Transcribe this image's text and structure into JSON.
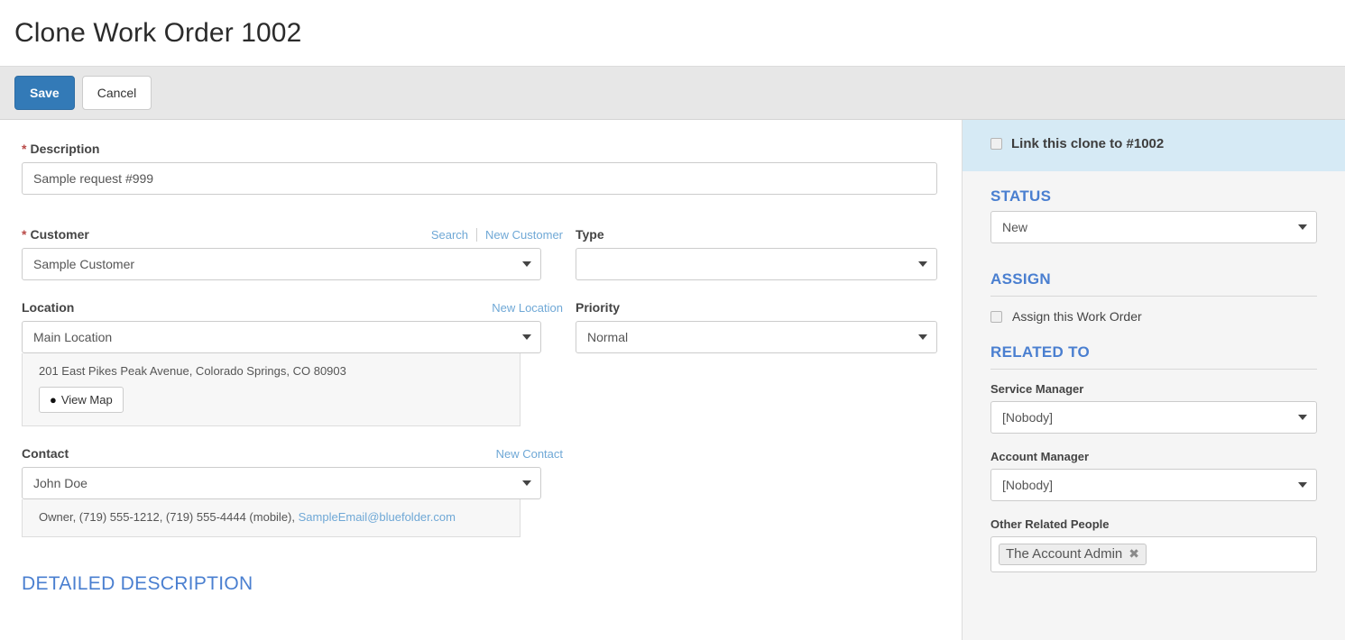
{
  "header": {
    "title": "Clone Work Order 1002"
  },
  "toolbar": {
    "save_label": "Save",
    "cancel_label": "Cancel"
  },
  "form": {
    "description": {
      "label": "Description",
      "required_marker": "*",
      "value": "Sample request #999"
    },
    "customer": {
      "label": "Customer",
      "required_marker": "*",
      "value": "Sample Customer",
      "search_link": "Search",
      "new_link": "New Customer"
    },
    "location": {
      "label": "Location",
      "new_link": "New Location",
      "value": "Main Location",
      "address": "201 East Pikes Peak Avenue, Colorado Springs, CO 80903",
      "view_map_label": "View Map",
      "pin_icon": "map-pin-icon"
    },
    "contact": {
      "label": "Contact",
      "new_link": "New Contact",
      "value": "John Doe",
      "details_prefix": "Owner, (719) 555-1212, (719) 555-4444 (mobile), ",
      "email": "SampleEmail@bluefolder.com"
    },
    "type": {
      "label": "Type",
      "value": ""
    },
    "priority": {
      "label": "Priority",
      "value": "Normal"
    },
    "detailed_description_heading": "DETAILED DESCRIPTION"
  },
  "sidebar": {
    "link_clone": {
      "label": "Link this clone to #1002",
      "checked": false
    },
    "status": {
      "heading": "STATUS",
      "value": "New"
    },
    "assign": {
      "heading": "ASSIGN",
      "checkbox_label": "Assign this Work Order",
      "checked": false
    },
    "related_to": {
      "heading": "RELATED TO",
      "service_manager": {
        "label": "Service Manager",
        "value": "[Nobody]"
      },
      "account_manager": {
        "label": "Account Manager",
        "value": "[Nobody]"
      },
      "other_related_people": {
        "label": "Other Related People",
        "tags": [
          {
            "name": "The Account Admin",
            "remove_icon": "close-icon"
          }
        ]
      }
    }
  },
  "colors": {
    "primary_button": "#337ab7",
    "link": "#6fa8d6",
    "heading_blue": "#4a7fd0",
    "banner_blue": "#d6eaf5",
    "toolbar_gray": "#e7e7e7",
    "required_red": "#b94a48"
  }
}
